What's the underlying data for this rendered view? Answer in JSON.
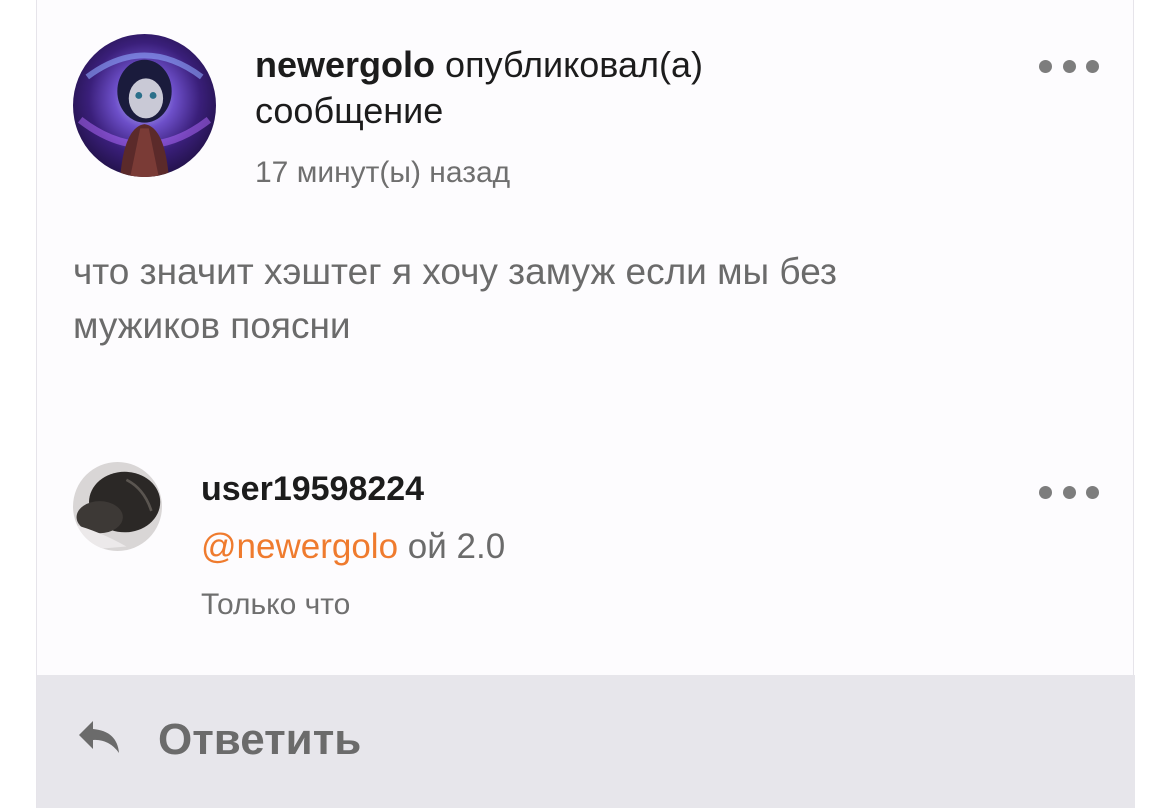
{
  "post": {
    "author": "newergolo",
    "action_text": "опубликовал(а)",
    "action_text_2": "сообщение",
    "timestamp": "17 минут(ы) назад",
    "body_line1": "что значит хэштег я хочу замуж если мы без",
    "body_line2": "мужиков поясни"
  },
  "comment": {
    "author": "user19598224",
    "mention": "@newergolo",
    "text": "ой 2.0",
    "timestamp": "Только что"
  },
  "reply_bar": {
    "label": "Ответить",
    "icon": "reply-arrow-icon"
  },
  "colors": {
    "mention": "#ef7b2e",
    "reply_bar_bg": "#e7e6eb",
    "muted_text": "#6b6b6b"
  }
}
